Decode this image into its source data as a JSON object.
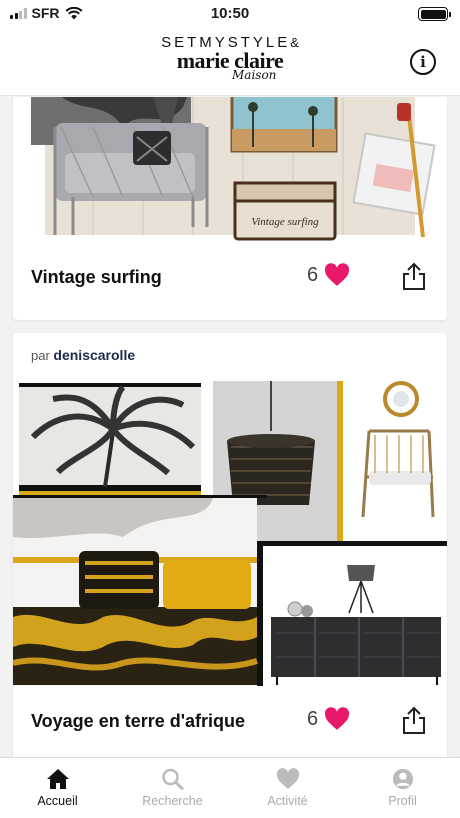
{
  "status_bar": {
    "carrier": "SFR",
    "time": "10:50"
  },
  "header": {
    "brand_line1": "SETMYSTYLE",
    "brand_amp": "&",
    "brand_line2": "marie claire",
    "brand_line3": "Maison"
  },
  "feed": {
    "cards": [
      {
        "title": "Vintage surfing",
        "likes": "6",
        "trunk_label": "Vintage surfing"
      },
      {
        "author_prefix": "par",
        "author": "deniscarolle",
        "title": "Voyage en terre d'afrique",
        "likes": "6"
      }
    ]
  },
  "tabbar": {
    "items": [
      {
        "label": "Accueil",
        "icon": "home-icon",
        "active": true
      },
      {
        "label": "Recherche",
        "icon": "search-icon",
        "active": false
      },
      {
        "label": "Activité",
        "icon": "heart-icon",
        "active": false
      },
      {
        "label": "Profil",
        "icon": "profile-icon",
        "active": false
      }
    ]
  },
  "colors": {
    "accent_heart": "#e8196a",
    "mustard": "#d9a91a",
    "tab_active": "#111111",
    "tab_inactive": "#aaaaaa"
  }
}
